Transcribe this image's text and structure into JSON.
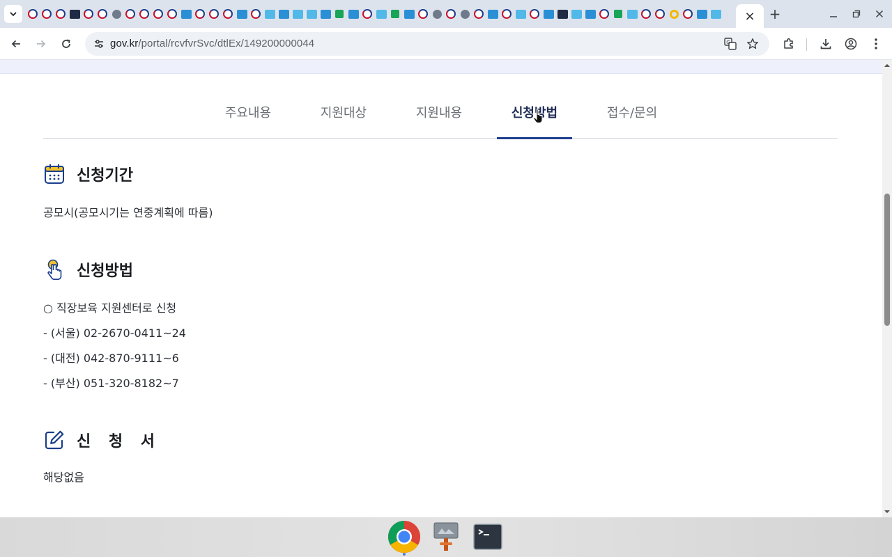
{
  "browser": {
    "tab_favicons": [
      "gov",
      "gov",
      "gov",
      "dark",
      "gov",
      "gov",
      "globe",
      "gov",
      "gov",
      "gov",
      "gov",
      "blue",
      "gov",
      "gov",
      "gov",
      "blue",
      "gov",
      "sky",
      "blue",
      "sky",
      "sky",
      "blue",
      "green",
      "blue",
      "gov",
      "sky",
      "green",
      "blue",
      "gov",
      "globe",
      "gov",
      "globe",
      "gov",
      "blue",
      "gov",
      "sky",
      "gov",
      "blue",
      "dark",
      "sky",
      "blue",
      "gov",
      "green",
      "sky",
      "gov",
      "gov",
      "yellow",
      "gov",
      "blue",
      "sky"
    ],
    "active_tab_close": "×",
    "new_tab": "+",
    "url_host": "gov.kr",
    "url_path": "/portal/rcvfvrSvc/dtlEx/149200000044"
  },
  "page": {
    "tabs": [
      {
        "label": "주요내용"
      },
      {
        "label": "지원대상"
      },
      {
        "label": "지원내용"
      },
      {
        "label": "신청방법"
      },
      {
        "label": "접수/문의"
      }
    ],
    "active_tab_index": 3,
    "sections": {
      "period": {
        "title": "신청기간",
        "icon": "calendar-icon",
        "text": "공모시(공모시기는 연중계획에 따름)"
      },
      "method": {
        "title": "신청방법",
        "icon": "hand-pointer-icon",
        "lines": [
          "○ 직장보육 지원센터로 신청",
          "- (서울) 02-2670-0411~24",
          "- (대전) 042-870-9111~6",
          "- (부산) 051-320-8182~7"
        ]
      },
      "form": {
        "title": "신 청 서",
        "icon": "edit-icon",
        "text": "해당없음"
      }
    }
  },
  "colors": {
    "active_tab": "#1f2c55",
    "active_underline": "#1d3f8e",
    "icon_blue": "#1a3e8c",
    "icon_yellow": "#f2c12e"
  },
  "taskbar": {
    "apps": [
      "chrome-icon",
      "image-viewer-icon",
      "terminal-icon"
    ]
  }
}
